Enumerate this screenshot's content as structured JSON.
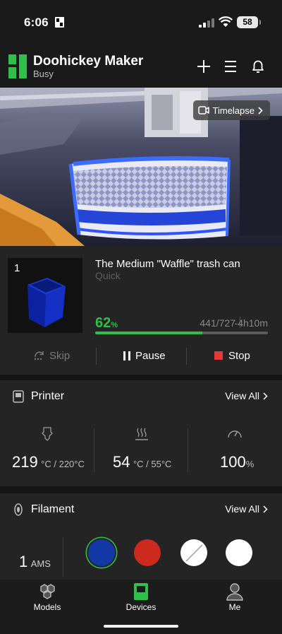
{
  "status_bar": {
    "time": "6:06",
    "battery": "58"
  },
  "header": {
    "title": "Doohickey Maker",
    "status": "Busy"
  },
  "camera": {
    "timelapse_label": "Timelapse"
  },
  "job": {
    "plate_number": "1",
    "title": "The Medium \"Waffle\" trash can",
    "profile": "Quick",
    "progress_percent": 62,
    "progress_percent_text": "62",
    "percent_unit": "%",
    "layers": "441/727",
    "remaining": "-4h10m",
    "skip_label": "Skip",
    "pause_label": "Pause",
    "stop_label": "Stop"
  },
  "printer": {
    "title": "Printer",
    "view_all": "View All",
    "nozzle": {
      "value": "219",
      "detail": "°C / 220°C"
    },
    "bed": {
      "value": "54",
      "detail": "°C / 55°C"
    },
    "fan": {
      "value": "100",
      "detail": "%"
    }
  },
  "filament": {
    "title": "Filament",
    "view_all": "View All",
    "ams_count": "1",
    "ams_label": "AMS",
    "spools": [
      {
        "color": "#1437a6",
        "selected": true
      },
      {
        "color": "#cc2a1e",
        "selected": false
      },
      {
        "color": "#ffffff",
        "selected": false,
        "empty": true
      },
      {
        "color": "#ffffff",
        "selected": false
      }
    ]
  },
  "tabs": [
    {
      "label": "Models"
    },
    {
      "label": "Devices",
      "active": true
    },
    {
      "label": "Me"
    }
  ],
  "colors": {
    "accent": "#2fbf4c",
    "stop": "#e03a3a",
    "background": "#1a1a1a",
    "card": "#242424"
  }
}
